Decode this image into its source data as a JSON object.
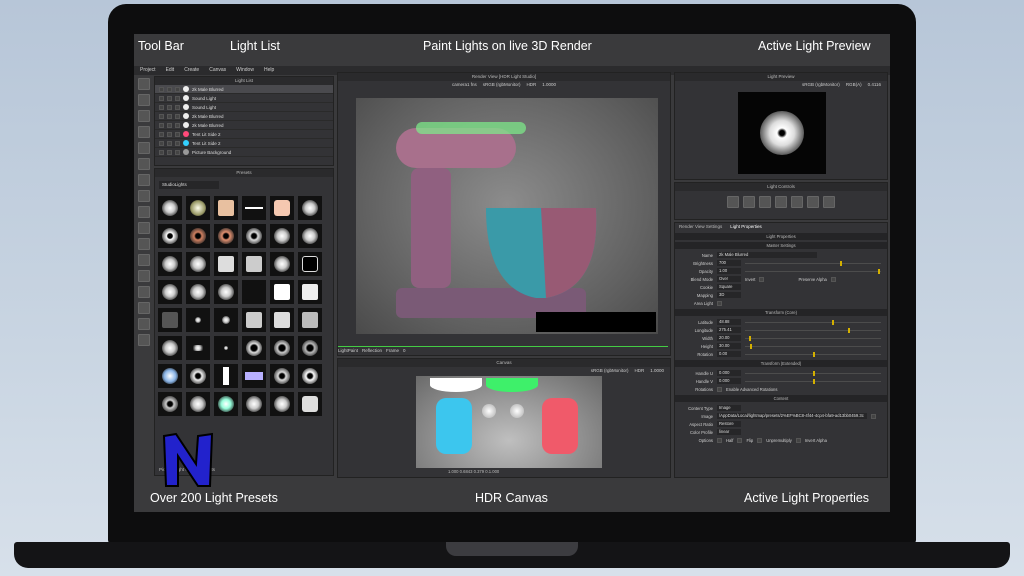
{
  "callouts": {
    "toolbar": "Tool Bar",
    "lightlist": "Light List",
    "paint": "Paint Lights on live 3D Render",
    "preview": "Active Light Preview",
    "presets": "Over 200 Light Presets",
    "canvas": "HDR Canvas",
    "props": "Active Light Properties"
  },
  "menu": [
    "Project",
    "Edit",
    "Create",
    "Canvas",
    "Window",
    "Help"
  ],
  "lightlist": {
    "title": "Light List",
    "items": [
      {
        "label": "2k Male Blurred",
        "color": "#eeeeee"
      },
      {
        "label": "Sound Light",
        "color": "#eeeeee"
      },
      {
        "label": "Sound Light",
        "color": "#eeeeee"
      },
      {
        "label": "2k Male Blurred",
        "color": "#eeeeee"
      },
      {
        "label": "2k Male Blurred",
        "color": "#eeeeee"
      },
      {
        "label": "Tent Lit Side 2",
        "color": "#ff4a7a"
      },
      {
        "label": "Tent Lit Side 2",
        "color": "#33d0ff"
      },
      {
        "label": "Picture Background",
        "color": "#999999"
      }
    ]
  },
  "presets": {
    "title": "Presets",
    "category": "StudioLights",
    "footer": "Picture Light 4, StudioLights"
  },
  "render": {
    "title": "Render View [HDR Light Studio]",
    "camera": "camera1 fns",
    "colorspace": "sRGB (rgbMonitor)",
    "mode": "HDR",
    "zoom": "1.0000",
    "lightpaint_label": "LightPaint",
    "lightpaint_mode": "Reflection",
    "frame_label": "Frame",
    "frame_value": "0"
  },
  "canvas": {
    "title": "Canvas",
    "colorspace": "sRGB (rgbMonitor)",
    "mode": "HDR",
    "zoom": "1.0000",
    "status": "1.000 0.6843 0.379 0.1.000"
  },
  "preview": {
    "title": "Light Preview",
    "colorspace": "sRGB (rgbMonitor)",
    "channel": "RGB(A)",
    "zoom": "0.4116"
  },
  "controls": {
    "title": "Light Controls"
  },
  "tabs": {
    "render_settings": "Render View Settings",
    "light_properties": "Light Properties"
  },
  "props": {
    "title": "Light Properties",
    "master": "Master Settings",
    "name_label": "Name",
    "name": "2k Male Blurred",
    "brightness_label": "Brightness",
    "brightness": "700",
    "opacity_label": "Opacity",
    "opacity": "1.00",
    "blend_label": "Blend Mode",
    "blend": "Over",
    "invert_label": "Invert",
    "preserve_label": "Preserve Alpha",
    "cookie_label": "Cookie",
    "cookie": "Square",
    "mapping_label": "Mapping",
    "mapping": "3D",
    "area_label": "Area Light",
    "transform": "Transform (Core)",
    "latitude_label": "Latitude",
    "latitude": "48.88",
    "longitude_label": "Longitude",
    "longitude": "275.41",
    "width_label": "Width",
    "width": "20.00",
    "height_label": "Height",
    "height": "30.00",
    "rotation_label": "Rotation",
    "rotation": "0.00",
    "transform_ext": "Transform (Extended)",
    "handleu_label": "Handle U",
    "handleu": "0.000",
    "handlev_label": "Handle V",
    "handlev": "0.000",
    "rotations_label": "Rotations",
    "adv_rot_label": "Enable Advanced Rotations",
    "content": "Content",
    "content_type_label": "Content Type",
    "content_type": "Image",
    "image_label": "Image",
    "image": "/AppData/Local/lightmap/presets/2%EF%BC8-4f44-4cp4-bfa9-ad13bb0459.3c",
    "aspect_label": "Aspect Ratio",
    "aspect": "Restore",
    "profile_label": "Color Profile",
    "profile": "linear",
    "options_label": "Options",
    "opt_half": "Half",
    "opt_flip": "Flip",
    "opt_unpremult": "Unpremultiply",
    "opt_invert_alpha": "Invert Alpha"
  }
}
